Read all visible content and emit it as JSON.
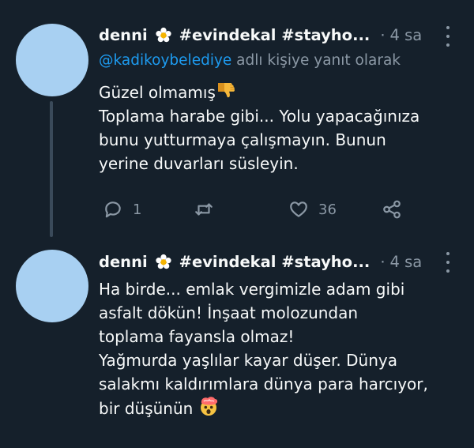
{
  "tweets": [
    {
      "user": "denni",
      "hashtags": "#evindekal #stayho...",
      "dot": "·",
      "time": "4 sa",
      "reply_prefix": "@kadikoybelediye",
      "reply_suffix": " adlı kişiye yanıt olarak",
      "lines": [
        "Güzel olmamış",
        "Toplama harabe gibi... Yolu yapacağınıza",
        "bunu yutturmaya çalışmayın. Bunun",
        "yerine duvarları süsleyin."
      ],
      "emoji_after_line1": "thumbs-down-icon",
      "stats": {
        "replies": "1",
        "likes": "36"
      }
    },
    {
      "user": "denni",
      "hashtags": "#evindekal #stayho...",
      "dot": "·",
      "time": "4 sa",
      "lines": [
        "Ha birde... emlak vergimizle adam gibi",
        "asfalt dökün! İnşaat molozundan",
        "toplama fayansla olmaz!",
        "Yağmurda yaşlılar kayar düşer. Dünya",
        "salakmı kaldırımlara dünya para harcıyor,",
        "bir düşünün"
      ],
      "emoji_end": "exploding-head-icon"
    }
  ],
  "colors": {
    "background": "#15202b",
    "text": "#f7f9f9",
    "muted": "#8b98a5",
    "link": "#1d9bf0",
    "avatar": "#a8d0f2"
  }
}
